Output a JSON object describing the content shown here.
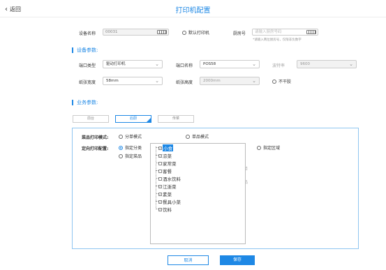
{
  "header": {
    "back_label": "返回",
    "title": "打印机配置"
  },
  "device": {
    "name_label": "设备名称",
    "name_value": "00031",
    "default_printer_label": "默认打印机",
    "kitchen_no_label": "厨房号",
    "kitchen_no_placeholder": "请输入厨房号码",
    "kitchen_no_hint": "*请输入两位厨房号，仅限非负数字"
  },
  "device_params": {
    "section_title": "设备参数:",
    "port_type_label": "端口类型",
    "port_type_value": "驱动打印机",
    "port_name_label": "端口名称",
    "port_name_value": "POS58",
    "baud_label": "波特率",
    "baud_value": "9600",
    "paper_width_label": "纸张宽度",
    "paper_width_value": "58mm",
    "paper_height_label": "纸张高度",
    "paper_height_value": "2000mm",
    "no_cut_label": "不干胶"
  },
  "business_params": {
    "section_title": "业务参数:",
    "tabs": [
      {
        "label": "前台"
      },
      {
        "label": "后厨"
      },
      {
        "label": "传菜"
      }
    ],
    "print_mode_label": "菜品打印模式:",
    "mode_single_order": "分单模式",
    "mode_single_item": "单品模式",
    "direction_label": "定向打印配置:",
    "opt_category": "指定分类",
    "opt_dish": "指定菜品",
    "opt_area": "指定区域",
    "opt_split": "分单",
    "opt_item": "单品",
    "tree": [
      {
        "label": "小食",
        "checked": true,
        "selected": true
      },
      {
        "label": "凉菜",
        "checked": true,
        "selected": false
      },
      {
        "label": "家常菜",
        "checked": false,
        "selected": false
      },
      {
        "label": "客餐",
        "checked": false,
        "selected": false
      },
      {
        "label": "酒水饮料",
        "checked": false,
        "selected": false
      },
      {
        "label": "江浙菜",
        "checked": true,
        "selected": false
      },
      {
        "label": "素菜",
        "checked": true,
        "selected": false
      },
      {
        "label": "餐具小菜",
        "checked": true,
        "selected": false
      },
      {
        "label": "饮料",
        "checked": true,
        "selected": false
      }
    ]
  },
  "footer": {
    "cancel_label": "取消",
    "save_label": "保存"
  },
  "colors": {
    "accent": "#1e88e5",
    "panel_border": "#8ec5f0"
  }
}
